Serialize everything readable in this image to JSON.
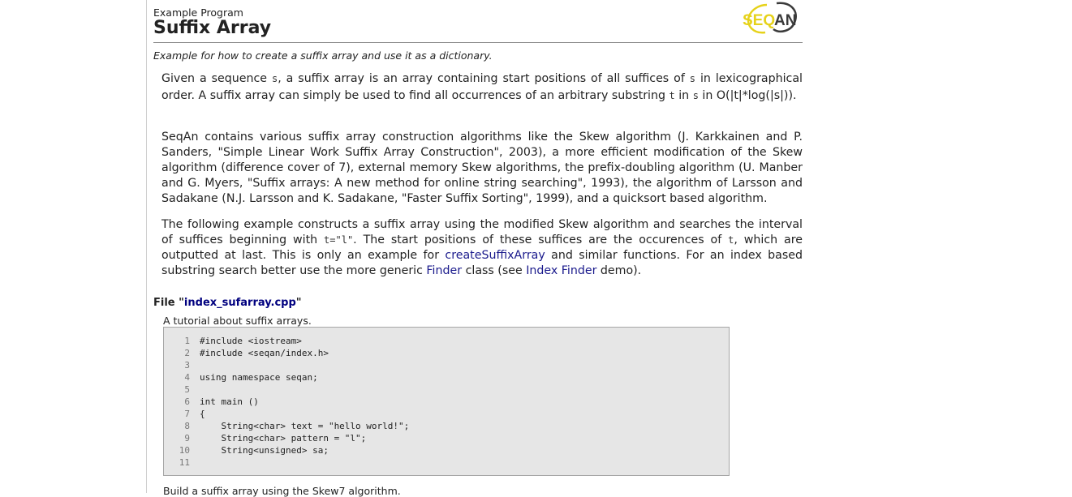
{
  "header": {
    "kicker": "Example Program",
    "title": "Suffix Array",
    "logo_text": "SEQAN"
  },
  "subtitle": "Example for how to create a suffix array and use it as a dictionary.",
  "para1": {
    "t1": "Given a sequence ",
    "c1": "s",
    "t2": ", a suffix array is an array containing start positions of all suffices of ",
    "c2": "s",
    "t3": " in lexicographical order. A suffix array can simply be used to find all occurrences of an arbitrary substring ",
    "c3": "t",
    "t4": " in ",
    "c4": "s",
    "t5": " in O(|t|*log(|s|))."
  },
  "para2": "SeqAn contains various suffix array construction algorithms like the Skew algorithm (J. Karkkainen and P. Sanders, \"Simple Linear Work Suffix Array Construction\", 2003), a more efficient modification of the Skew algorithm (difference cover of 7), external memory Skew algorithms, the prefix-doubling algorithm (U. Manber and G. Myers, \"Suffix arrays: A new method for online string searching\", 1993), the algorithm of Larsson and Sadakane (N.J. Larsson and K. Sadakane, \"Faster Suffix Sorting\", 1999), and a quicksort based algorithm.",
  "para3": {
    "t1": "The following example constructs a suffix array using the modified Skew algorithm and searches the interval of suffices beginning with ",
    "c1": "t=\"l\"",
    "t2": ". The start positions of these suffices are the occurences of ",
    "c2": "t",
    "t3": ", which are outputted at last. This is only an example for ",
    "link1": "createSuffixArray",
    "t4": " and similar functions. For an index based substring search better use the more generic ",
    "link2": "Finder",
    "t5": " class (see ",
    "link3": "Index Finder",
    "t6": " demo)."
  },
  "file": {
    "prefix": "File \"",
    "name": "index_sufarray.cpp",
    "suffix": "\"",
    "description": "A tutorial about suffix arrays."
  },
  "code": [
    {
      "num": "1",
      "text": "#include <iostream>"
    },
    {
      "num": "2",
      "text": "#include <seqan/index.h>"
    },
    {
      "num": "3",
      "text": ""
    },
    {
      "num": "4",
      "text": "using namespace seqan;"
    },
    {
      "num": "5",
      "text": ""
    },
    {
      "num": "6",
      "text": "int main ()"
    },
    {
      "num": "7",
      "text": "{"
    },
    {
      "num": "8",
      "text": "    String<char> text = \"hello world!\";"
    },
    {
      "num": "9",
      "text": "    String<char> pattern = \"l\";"
    },
    {
      "num": "10",
      "text": "    String<unsigned> sa;"
    },
    {
      "num": "11",
      "text": ""
    }
  ],
  "after_code": "Build a suffix array using the Skew7 algorithm.",
  "colors": {
    "link": "#1a1a8c",
    "logo_yellow": "#e6d21a",
    "logo_dark": "#3a3a3a",
    "code_bg": "#e6e6e6"
  }
}
